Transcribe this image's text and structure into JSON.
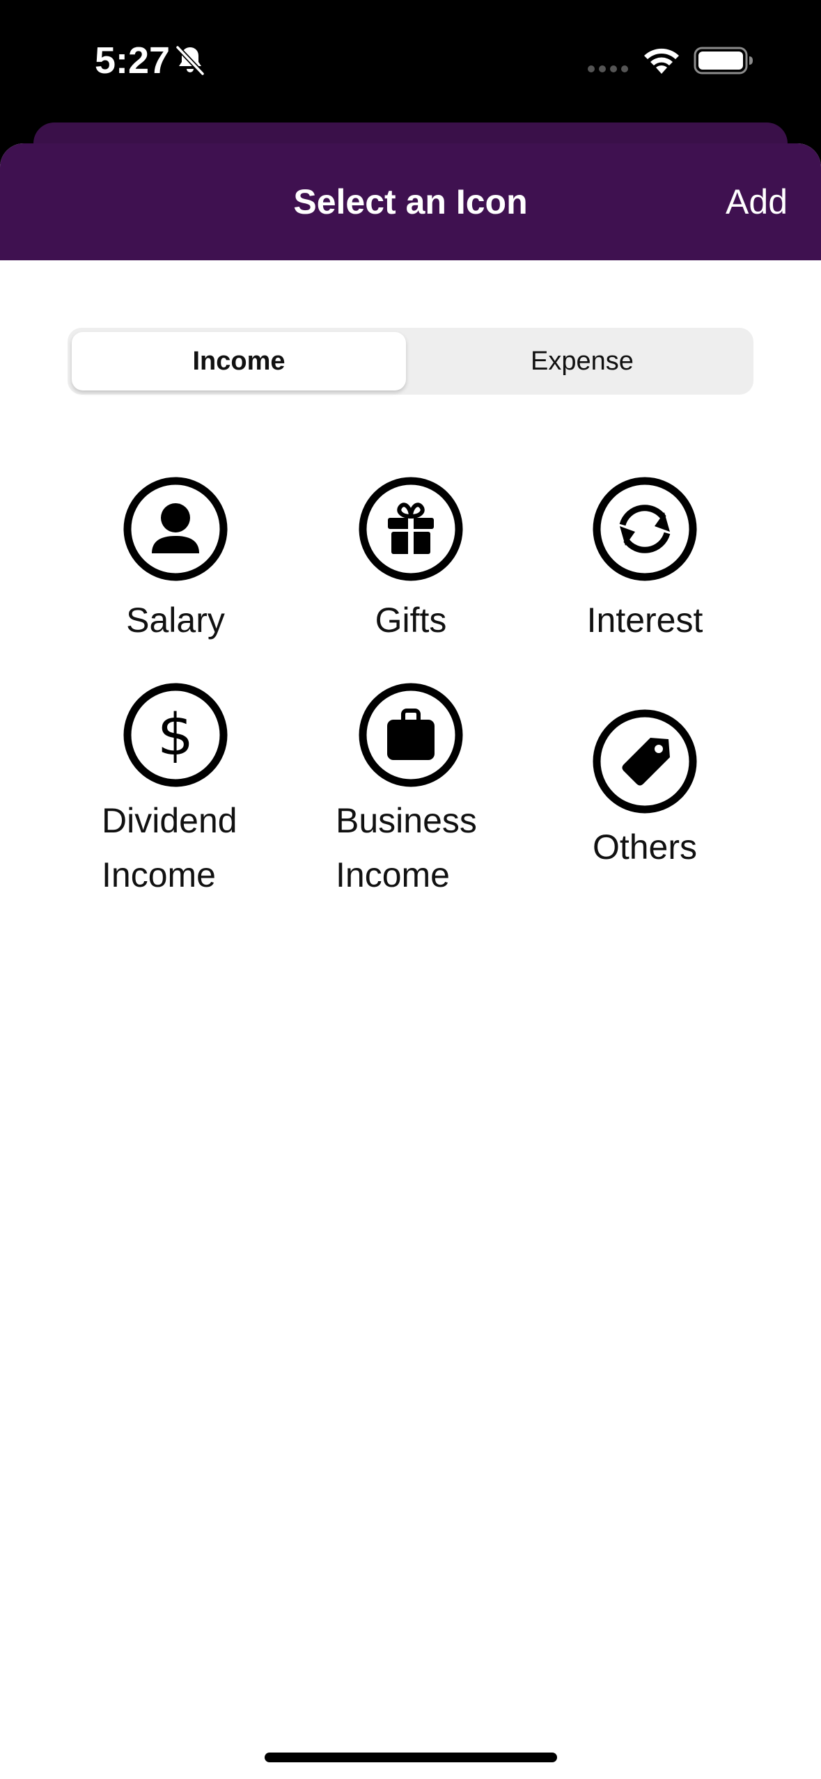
{
  "status_bar": {
    "time": "5:27",
    "icons": [
      "bell-slash-icon",
      "signal-dots-icon",
      "wifi-icon",
      "battery-icon"
    ]
  },
  "nav": {
    "title": "Select an Icon",
    "add_label": "Add",
    "background_color": "#3f1150"
  },
  "segmented_control": {
    "options": [
      "Income",
      "Expense"
    ],
    "selected": "Income"
  },
  "icons": [
    {
      "label": "Salary",
      "icon": "person-icon"
    },
    {
      "label": "Gifts",
      "icon": "gift-icon"
    },
    {
      "label": "Interest",
      "icon": "refresh-icon"
    },
    {
      "label": "Dividend\nIncome",
      "icon": "dollar-icon"
    },
    {
      "label": "Business\nIncome",
      "icon": "briefcase-icon"
    },
    {
      "label": "Others",
      "icon": "tag-icon"
    }
  ]
}
